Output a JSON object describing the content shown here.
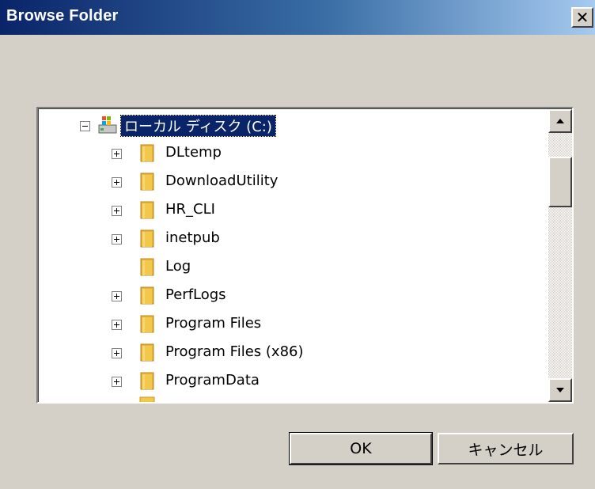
{
  "window": {
    "title": "Browse Folder",
    "close_glyph": "✕"
  },
  "tree": {
    "root": {
      "label": "ローカル ディスク (C:)",
      "icon": "drive-icon",
      "expanded": true,
      "selected": true
    },
    "items": [
      {
        "label": "DLtemp",
        "has_children": true
      },
      {
        "label": "DownloadUtility",
        "has_children": true
      },
      {
        "label": "HR_CLI",
        "has_children": true
      },
      {
        "label": "inetpub",
        "has_children": true
      },
      {
        "label": "Log",
        "has_children": false
      },
      {
        "label": "PerfLogs",
        "has_children": true
      },
      {
        "label": "Program Files",
        "has_children": true
      },
      {
        "label": "Program Files (x86)",
        "has_children": true
      },
      {
        "label": "ProgramData",
        "has_children": true
      }
    ]
  },
  "buttons": {
    "ok_label": "OK",
    "cancel_label": "キャンセル"
  },
  "colors": {
    "titlebar_start": "#0a246a",
    "titlebar_end": "#a6caf0",
    "face": "#d4d0c8",
    "selection": "#0a246a",
    "folder": "#f2c84b"
  }
}
